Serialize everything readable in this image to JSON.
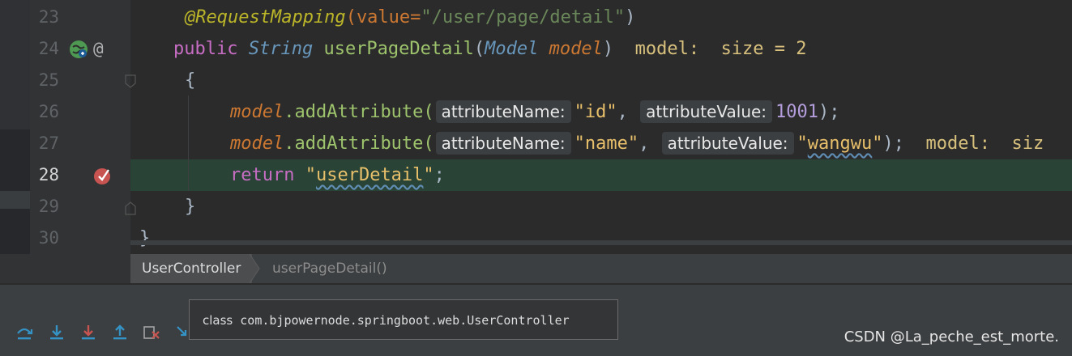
{
  "editor": {
    "lines": [
      {
        "num": "23"
      },
      {
        "num": "24"
      },
      {
        "num": "25"
      },
      {
        "num": "26"
      },
      {
        "num": "27"
      },
      {
        "num": "28"
      },
      {
        "num": "29"
      },
      {
        "num": "30"
      }
    ],
    "code": {
      "l23_annotation": "@RequestMapping",
      "l23_paren_open": "(",
      "l23_attr": "value=",
      "l23_string": "\"/user/page/detail\"",
      "l23_paren_close": ")",
      "l24_public": "public ",
      "l24_type": "String",
      "l24_method": "userPageDetail",
      "l24_paren_open": "(",
      "l24_param_type": "Model",
      "l24_param_name": "model",
      "l24_paren_close": ")",
      "l24_inline": "model:  size = 2",
      "l24_at_icon": "@",
      "l25_brace": "{",
      "l26_obj": "model",
      "l26_call": ".addAttribute(",
      "l26_hint_name": "attributeName:",
      "l26_arg1": "\"id\"",
      "l26_comma": ", ",
      "l26_hint_value": "attributeValue:",
      "l26_arg2": "1001",
      "l26_end": ");",
      "l27_obj": "model",
      "l27_call": ".addAttribute(",
      "l27_hint_name": "attributeName:",
      "l27_arg1": "\"name\"",
      "l27_comma": ", ",
      "l27_hint_value": "attributeValue:",
      "l27_arg2_q1": "\"",
      "l27_arg2": "wangwu",
      "l27_arg2_q2": "\"",
      "l27_end": ");",
      "l27_inline": "model:  siz",
      "l28_return": "return ",
      "l28_q1": "\"",
      "l28_string": "userDetail",
      "l28_q2": "\"",
      "l28_end": ";",
      "l29_brace": "}",
      "l30_brace": "}"
    }
  },
  "breadcrumb": {
    "class_name": "UserController",
    "separator": ">",
    "method": "userPageDetail()"
  },
  "tooltip": {
    "keyword": "class",
    "text": " com.bjpowernode.springboot.web.UserController"
  },
  "watermark": "CSDN @La_peche_est_morte.",
  "colors": {
    "editor_bg": "#2b2b2b",
    "current_line_bg": "#294436",
    "breakpoint": "#c75450",
    "keyword": "#cc7832",
    "string": "#6a8759",
    "method": "#ffc66d",
    "annotation": "#bbb529",
    "debug_step_blue": "#3592c4",
    "debug_step_red": "#c75450"
  },
  "icons": [
    "web-mapping-icon",
    "override-at-icon",
    "breakpoint-icon",
    "step-over-icon",
    "step-into-icon",
    "force-step-into-icon",
    "step-out-icon",
    "drop-frame-icon",
    "run-to-cursor-icon"
  ]
}
